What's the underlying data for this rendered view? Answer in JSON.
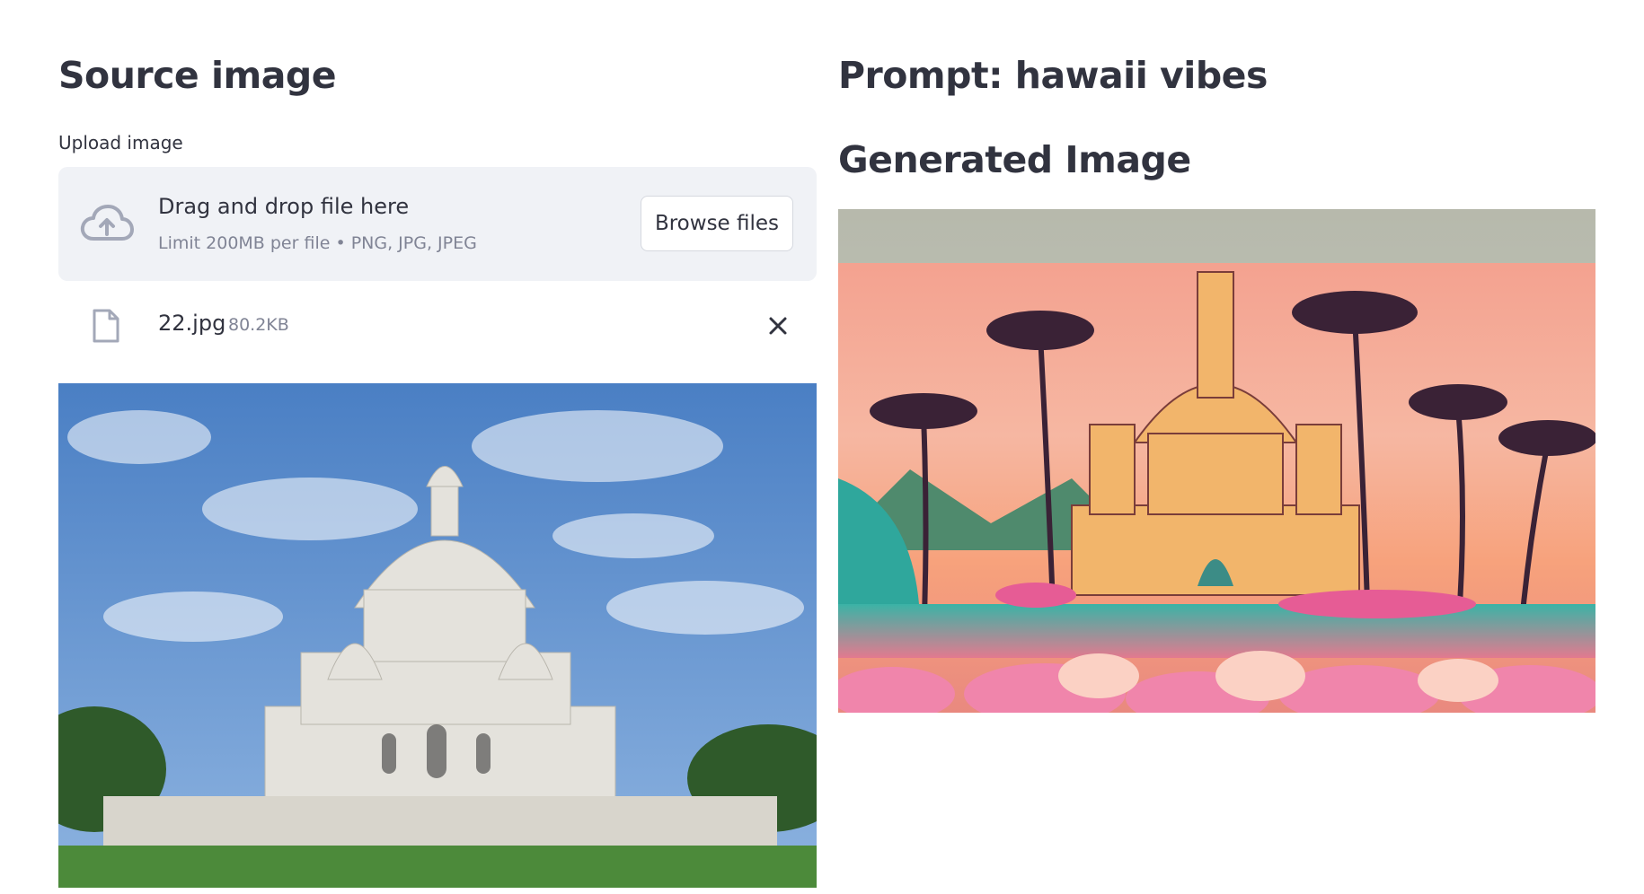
{
  "left": {
    "heading": "Source image",
    "upload_label": "Upload image",
    "dropzone": {
      "title": "Drag and drop file here",
      "subtitle": "Limit 200MB per file • PNG, JPG, JPEG",
      "browse_label": "Browse files",
      "icon": "cloud-upload-icon"
    },
    "file": {
      "name": "22.jpg",
      "size": "80.2KB",
      "icon": "file-icon",
      "remove_icon": "close-icon"
    }
  },
  "right": {
    "prompt_heading": "Prompt: hawaii vibes",
    "generated_heading": "Generated Image"
  },
  "colors": {
    "text": "#31333f",
    "muted": "#808495",
    "dropzone_bg": "#f0f2f6",
    "icon": "#a3a8b8"
  }
}
